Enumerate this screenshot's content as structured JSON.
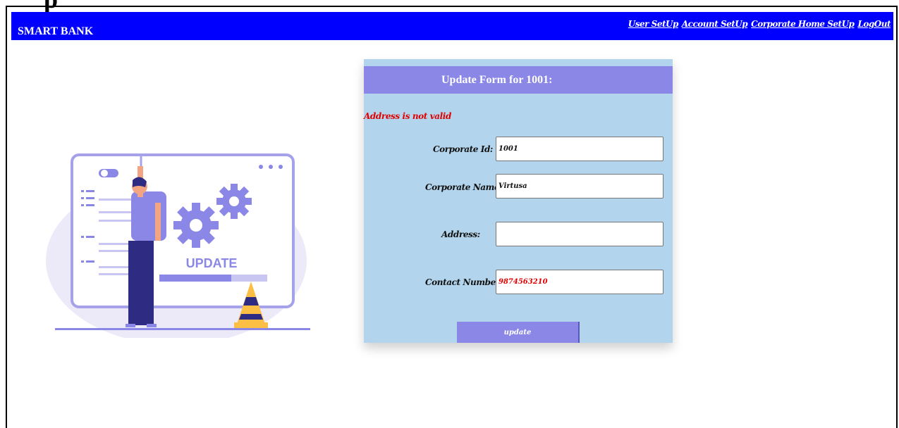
{
  "page": {
    "top_cut_text": "p"
  },
  "navbar": {
    "brand": "SMART BANK",
    "links": [
      "User SetUp",
      "Account SetUp",
      "Corporate Home SetUp",
      "LogOut"
    ],
    "background": "#0000ff"
  },
  "illustration": {
    "caption": "UPDATE",
    "icon": "update-illustration"
  },
  "form": {
    "title": "Update Form for 1001:",
    "error": "Address is not valid",
    "fields": [
      {
        "label": "Corporate Id:",
        "value": "1001",
        "placeholder": ""
      },
      {
        "label": "Corporate Name:",
        "value": "Virtusa",
        "placeholder": ""
      },
      {
        "label": "Address:",
        "value": "",
        "placeholder": ""
      },
      {
        "label": "Contact Number:",
        "value": "9874563210",
        "placeholder": ""
      }
    ],
    "submit_label": "update",
    "card_color": "#b2d4ec",
    "accent_color": "#8b87e6",
    "error_color": "#e00000"
  }
}
